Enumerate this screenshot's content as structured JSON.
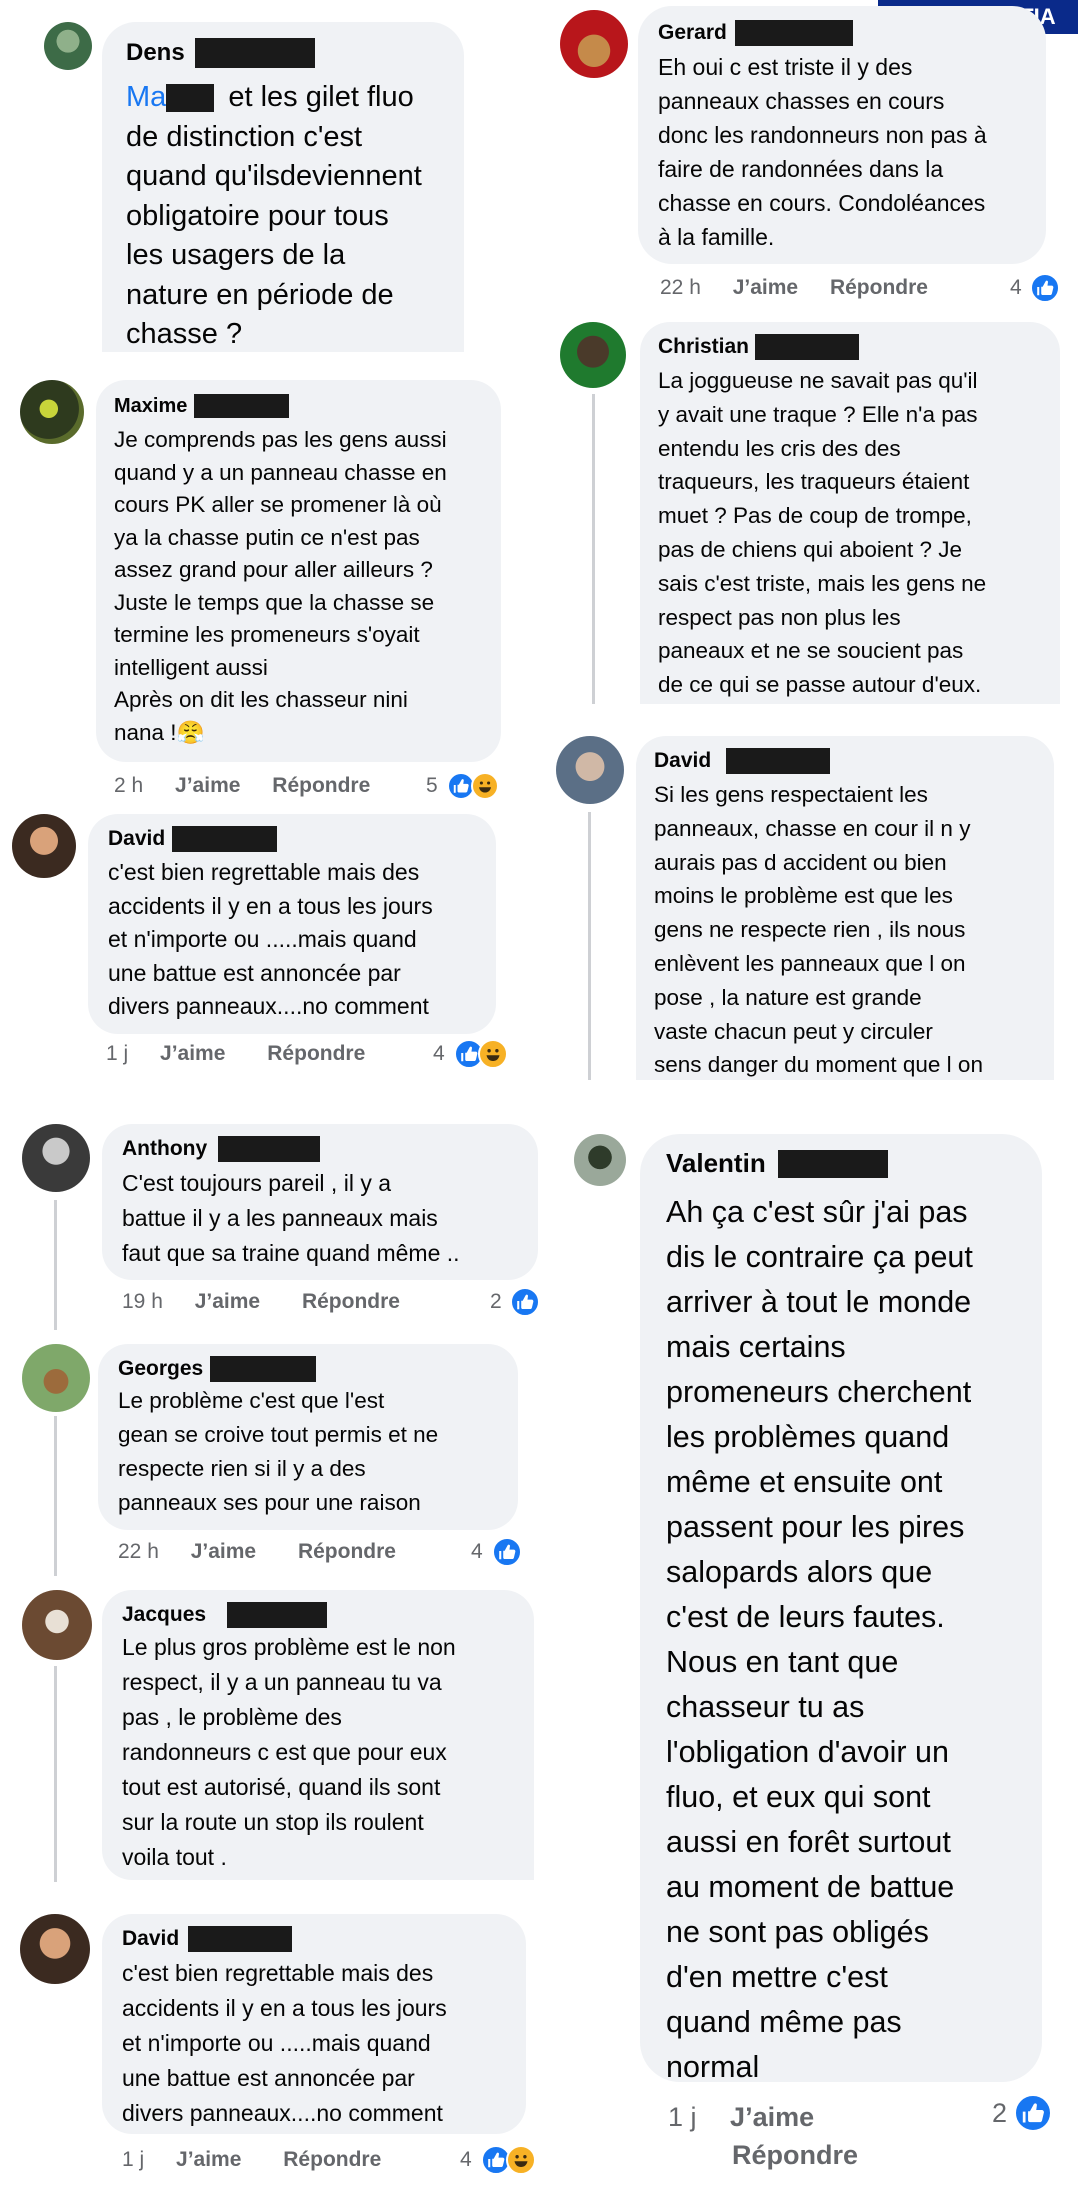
{
  "watermark": "NOS VIVENTIA",
  "actions": {
    "like": "J’aime",
    "reply": "Répondre"
  },
  "left": [
    {
      "name": "Dens",
      "mention": "Ma",
      "text": "et les gilet fluo\nde distinction c'est\nquand qu'ilsdeviennent\nobligatoire pour tous\nles usagers de la\nnature en période de\nchasse ?"
    },
    {
      "name": "Maxime",
      "text": "Je comprends pas les gens aussi\nquand y a un panneau chasse en\ncours PK aller se promener là où\nya la chasse putin ce n'est pas\nassez grand pour aller ailleurs ?\nJuste le temps que la chasse se\ntermine les promeneurs s'oyait\nintelligent aussi\nAprès on dit les chasseur nini\nnana !😤",
      "time": "2 h",
      "count": "5"
    },
    {
      "name": "David",
      "text": "c'est bien regrettable mais des\naccidents il y en a tous les jours\net n'importe ou  .....mais  quand\nune battue est annoncée par\ndivers panneaux....no comment",
      "time": "1 j",
      "count": "4"
    },
    {
      "name": "Anthony",
      "text": "C'est toujours pareil , il y a\nbattue il y a les panneaux mais\nfaut que sa traine quand même ..",
      "time": "19 h",
      "count": "2"
    },
    {
      "name": "Georges",
      "text": "Le problème c'est que  l'est\ngean se croive tout permis et  ne\nrespecte rien  si il y a des\npanneaux  ses pour  une  raison",
      "time": "22 h",
      "count": "4"
    },
    {
      "name": "Jacques",
      "text": "Le plus gros problème est le non\nrespect,  il y a un panneau tu va\npas , le problème des\nrandonneurs c est que pour eux\ntout est autorisé,  quand ils sont\nsur la route un stop ils roulent\nvoila tout ."
    },
    {
      "name": "David",
      "text": "c'est bien regrettable mais des\naccidents il y en a tous les jours\net n'importe ou  .....mais  quand\nune battue est annoncée par\ndivers panneaux....no comment",
      "time": "1 j",
      "count": "4"
    }
  ],
  "right": [
    {
      "name": "Gerard",
      "text": "Eh oui c est triste il y des\npanneaux chasses en cours\ndonc les randonneurs non pas à\nfaire de randonnées dans la\nchasse en cours. Condoléances\nà la famille.",
      "time": "22 h",
      "count": "4"
    },
    {
      "name": "Christian",
      "text": "La joggueuse ne savait pas qu'il\ny avait une traque ?  Elle n'a pas\nentendu les cris des des\ntraqueurs, les traqueurs étaient\nmuet ? Pas de coup de trompe,\npas de chiens qui aboient ? Je\nsais c'est triste, mais les gens ne\nrespect pas non plus les\npaneaux et ne se soucient pas\nde ce qui se passe autour d'eux."
    },
    {
      "name": "David",
      "text": "Si les gens respectaient les\npanneaux,  chasse en cour  il n y\naurais pas d accident ou bien\nmoins le problème est que les\ngens ne respecte rien , ils nous\nenlèvent les panneaux que l on\npose ,  la nature est grande\nvaste chacun peut y circuler\nsens danger du moment que l on"
    },
    {
      "name": "Valentin",
      "text": "Ah ça c'est sûr j'ai pas\ndis le contraire ça peut\narriver à tout le monde\nmais certains\npromeneurs cherchent\nles problèmes quand\nmême et ensuite ont\npassent pour les pires\nsalopards alors que\nc'est de leurs fautes.\nNous en tant que\nchasseur tu as\nl'obligation d'avoir un\nfluo, et eux qui sont\naussi en forêt surtout\nau moment de battue\nne sont pas obligés\nd'en mettre c'est\nquand même pas\nnormal",
      "time": "1 j",
      "count": "2"
    }
  ],
  "colors": {
    "like": "#1877f2",
    "bubble": "#f0f2f5",
    "mention": "#1877f2",
    "watermark": "#0a2a8a"
  }
}
